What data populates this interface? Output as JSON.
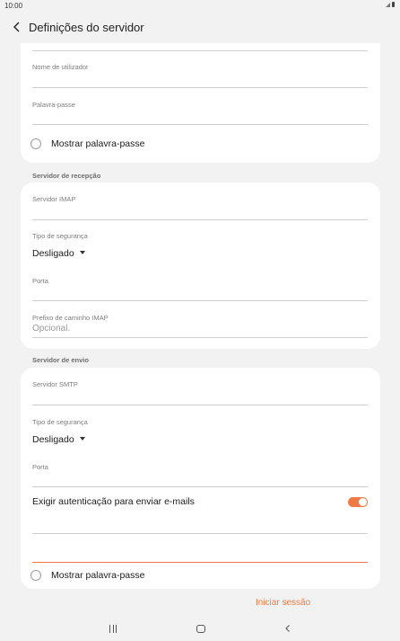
{
  "status_bar": {
    "time": "10:00"
  },
  "app_bar": {
    "title": "Definições do servidor"
  },
  "account_card": {
    "username_label": "Nome de utilizador",
    "password_label": "Palavra-passe",
    "show_password_label": "Mostrar palavra-passe"
  },
  "incoming": {
    "section_title": "Servidor de recepção",
    "server_label": "Servidor IMAP",
    "security_label": "Tipo de segurança",
    "security_value": "Desligado",
    "port_label": "Porta",
    "prefix_label": "Prefixo de caminho IMAP",
    "prefix_placeholder": "Opcional."
  },
  "outgoing": {
    "section_title": "Servidor de envio",
    "server_label": "Servidor SMTP",
    "security_label": "Tipo de segurança",
    "security_value": "Desligado",
    "port_label": "Porta",
    "require_auth_label": "Exigir autenticação para enviar e-mails",
    "require_auth_on": true,
    "show_password_label": "Mostrar palavra-passe"
  },
  "actions": {
    "sign_in_label": "Iniciar sessão"
  },
  "colors": {
    "accent": "#f07a45",
    "background": "#f2f2f2",
    "card": "#ffffff"
  }
}
